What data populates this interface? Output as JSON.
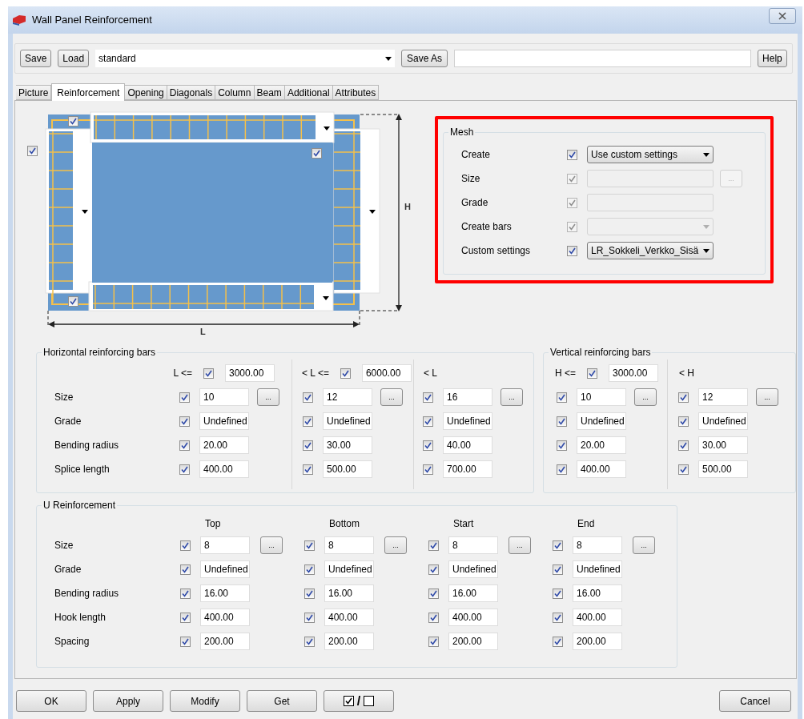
{
  "window": {
    "title": "Wall Panel Reinforcement"
  },
  "toolbar": {
    "save": "Save",
    "load": "Load",
    "preset": "standard",
    "save_as": "Save As",
    "help": "Help"
  },
  "tabs": [
    {
      "label": "Picture",
      "selected": false
    },
    {
      "label": "Reinforcement",
      "selected": true
    },
    {
      "label": "Opening",
      "selected": false
    },
    {
      "label": "Diagonals",
      "selected": false
    },
    {
      "label": "Column",
      "selected": false
    },
    {
      "label": "Beam",
      "selected": false
    },
    {
      "label": "Additional",
      "selected": false
    },
    {
      "label": "Attributes",
      "selected": false
    }
  ],
  "diagram": {
    "checkboxes": [
      {
        "checked": true
      },
      {
        "checked": true
      },
      {
        "checked": true
      },
      {
        "checked": true
      }
    ],
    "height_label": "H",
    "length_label": "L"
  },
  "mesh": {
    "title": "Mesh",
    "rows": [
      {
        "label": "Create",
        "checked": true,
        "disabled": false,
        "kind": "dropdown",
        "value": "Use custom settings"
      },
      {
        "label": "Size",
        "checked": true,
        "disabled": true,
        "kind": "text",
        "browse": "..."
      },
      {
        "label": "Grade",
        "checked": true,
        "disabled": true,
        "kind": "text"
      },
      {
        "label": "Create bars",
        "checked": true,
        "disabled": true,
        "kind": "dropdown"
      },
      {
        "label": "Custom settings",
        "checked": true,
        "disabled": false,
        "kind": "dropdown",
        "value": "LR_Sokkeli_Verkko_Sisä"
      }
    ]
  },
  "horizontal_bars": {
    "title": "Horizontal reinforcing bars",
    "row_labels": [
      "Size",
      "Grade",
      "Bending radius",
      "Splice length"
    ],
    "columns": [
      {
        "header": "L <=",
        "limit": {
          "checked": true,
          "value": "3000.00"
        },
        "cells": [
          {
            "checked": true,
            "value": "10",
            "browse": "..."
          },
          {
            "checked": true,
            "value": "Undefined"
          },
          {
            "checked": true,
            "value": "20.00"
          },
          {
            "checked": true,
            "value": "400.00"
          }
        ]
      },
      {
        "header": "< L <=",
        "limit": {
          "checked": true,
          "value": "6000.00"
        },
        "cells": [
          {
            "checked": true,
            "value": "12",
            "browse": "..."
          },
          {
            "checked": true,
            "value": "Undefined"
          },
          {
            "checked": true,
            "value": "30.00"
          },
          {
            "checked": true,
            "value": "500.00"
          }
        ]
      },
      {
        "header": "< L",
        "cells": [
          {
            "checked": true,
            "value": "16",
            "browse": "..."
          },
          {
            "checked": true,
            "value": "Undefined"
          },
          {
            "checked": true,
            "value": "40.00"
          },
          {
            "checked": true,
            "value": "700.00"
          }
        ]
      }
    ]
  },
  "vertical_bars": {
    "title": "Vertical reinforcing bars",
    "columns": [
      {
        "header": "H <=",
        "limit": {
          "checked": true,
          "value": "3000.00"
        },
        "cells": [
          {
            "checked": true,
            "value": "10",
            "browse": "..."
          },
          {
            "checked": true,
            "value": "Undefined"
          },
          {
            "checked": true,
            "value": "20.00"
          },
          {
            "checked": true,
            "value": "400.00"
          }
        ]
      },
      {
        "header": "< H",
        "cells": [
          {
            "checked": true,
            "value": "12",
            "browse": "..."
          },
          {
            "checked": true,
            "value": "Undefined"
          },
          {
            "checked": true,
            "value": "30.00"
          },
          {
            "checked": true,
            "value": "500.00"
          }
        ]
      }
    ]
  },
  "u_reinforcement": {
    "title": "U Reinforcement",
    "row_labels": [
      "Size",
      "Grade",
      "Bending radius",
      "Hook length",
      "Spacing"
    ],
    "columns": [
      {
        "header": "Top",
        "cells": [
          {
            "checked": true,
            "value": "8",
            "browse": "..."
          },
          {
            "checked": true,
            "value": "Undefined"
          },
          {
            "checked": true,
            "value": "16.00"
          },
          {
            "checked": true,
            "value": "400.00"
          },
          {
            "checked": true,
            "value": "200.00"
          }
        ]
      },
      {
        "header": "Bottom",
        "cells": [
          {
            "checked": true,
            "value": "8",
            "browse": "..."
          },
          {
            "checked": true,
            "value": "Undefined"
          },
          {
            "checked": true,
            "value": "16.00"
          },
          {
            "checked": true,
            "value": "400.00"
          },
          {
            "checked": true,
            "value": "200.00"
          }
        ]
      },
      {
        "header": "Start",
        "cells": [
          {
            "checked": true,
            "value": "8",
            "browse": "..."
          },
          {
            "checked": true,
            "value": "Undefined"
          },
          {
            "checked": true,
            "value": "16.00"
          },
          {
            "checked": true,
            "value": "400.00"
          },
          {
            "checked": true,
            "value": "200.00"
          }
        ]
      },
      {
        "header": "End",
        "cells": [
          {
            "checked": true,
            "value": "8",
            "browse": "..."
          },
          {
            "checked": true,
            "value": "Undefined"
          },
          {
            "checked": true,
            "value": "16.00"
          },
          {
            "checked": true,
            "value": "400.00"
          },
          {
            "checked": true,
            "value": "200.00"
          }
        ]
      }
    ]
  },
  "footer": {
    "buttons": [
      {
        "kind": "text",
        "label": "OK"
      },
      {
        "kind": "text",
        "label": "Apply"
      },
      {
        "kind": "text",
        "label": "Modify"
      },
      {
        "kind": "text",
        "label": "Get"
      },
      {
        "kind": "toggle",
        "label": "/"
      }
    ],
    "cancel": "Cancel"
  }
}
